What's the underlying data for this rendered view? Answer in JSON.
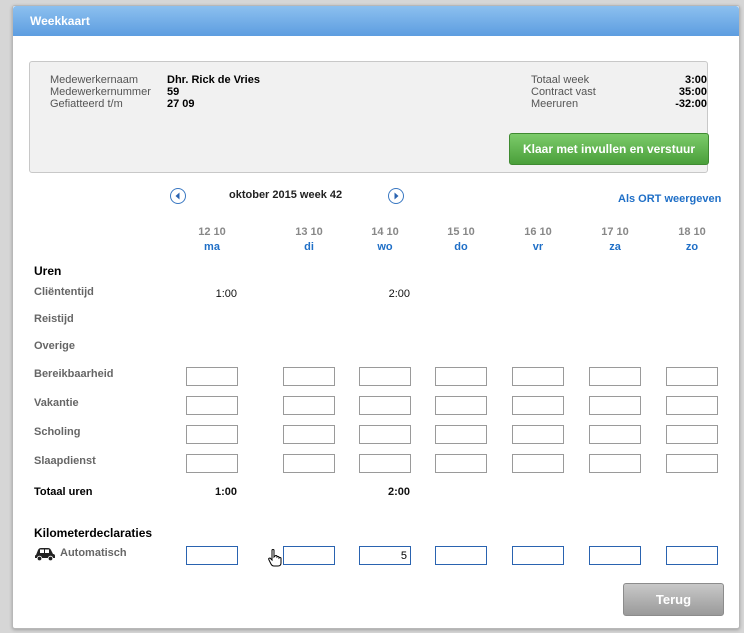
{
  "window": {
    "title": "Weekkaart"
  },
  "employee": {
    "name_label": "Medewerkernaam",
    "name": "Dhr. Rick de Vries",
    "number_label": "Medewerkernummer",
    "number": "59",
    "signed_label": "Gefiatteerd t/m",
    "signed": "27 09"
  },
  "summary": {
    "total_label": "Totaal week",
    "total": "3:00",
    "contract_label": "Contract vast",
    "contract": "35:00",
    "extra_label": "Meeruren",
    "extra": "-32:00"
  },
  "actions": {
    "send_label": "Klaar met invullen en verstuur",
    "back_label": "Terug",
    "ort_label": "Als ORT weergeven"
  },
  "week": {
    "title": "oktober 2015 week 42"
  },
  "days": [
    {
      "date": "12 10",
      "name": "ma"
    },
    {
      "date": "13 10",
      "name": "di"
    },
    {
      "date": "14 10",
      "name": "wo"
    },
    {
      "date": "15 10",
      "name": "do"
    },
    {
      "date": "16 10",
      "name": "vr"
    },
    {
      "date": "17 10",
      "name": "za"
    },
    {
      "date": "18 10",
      "name": "zo"
    }
  ],
  "hours": {
    "section_label": "Uren",
    "rows": {
      "clienttijd": {
        "label": "Cliëntentijd",
        "values": [
          "1:00",
          "",
          "2:00",
          "",
          "",
          "",
          ""
        ]
      },
      "reistijd": {
        "label": "Reistijd"
      },
      "overige": {
        "label": "Overige"
      },
      "bereikbaarheid": {
        "label": "Bereikbaarheid",
        "values": [
          "",
          "",
          "",
          "",
          "",
          "",
          ""
        ]
      },
      "vakantie": {
        "label": "Vakantie",
        "values": [
          "",
          "",
          "",
          "",
          "",
          "",
          ""
        ]
      },
      "scholing": {
        "label": "Scholing",
        "values": [
          "",
          "",
          "",
          "",
          "",
          "",
          ""
        ]
      },
      "slaapdienst": {
        "label": "Slaapdienst",
        "values": [
          "",
          "",
          "",
          "",
          "",
          "",
          ""
        ]
      }
    },
    "total_label": "Totaal uren",
    "totals": [
      "1:00",
      "",
      "2:00",
      "",
      "",
      "",
      ""
    ]
  },
  "km": {
    "section_label": "Kilometerdeclaraties",
    "auto_label": "Automatisch",
    "values": [
      "",
      "",
      "5",
      "",
      "",
      "",
      ""
    ]
  },
  "icons": {
    "prev": "chevron-left-circle-icon",
    "next": "chevron-right-circle-icon",
    "car": "car-icon",
    "cursor": "hand-cursor-icon"
  },
  "colors": {
    "accent": "#1f6fc7",
    "send": "#5aae48",
    "titlebar": "#6aa7e6"
  }
}
